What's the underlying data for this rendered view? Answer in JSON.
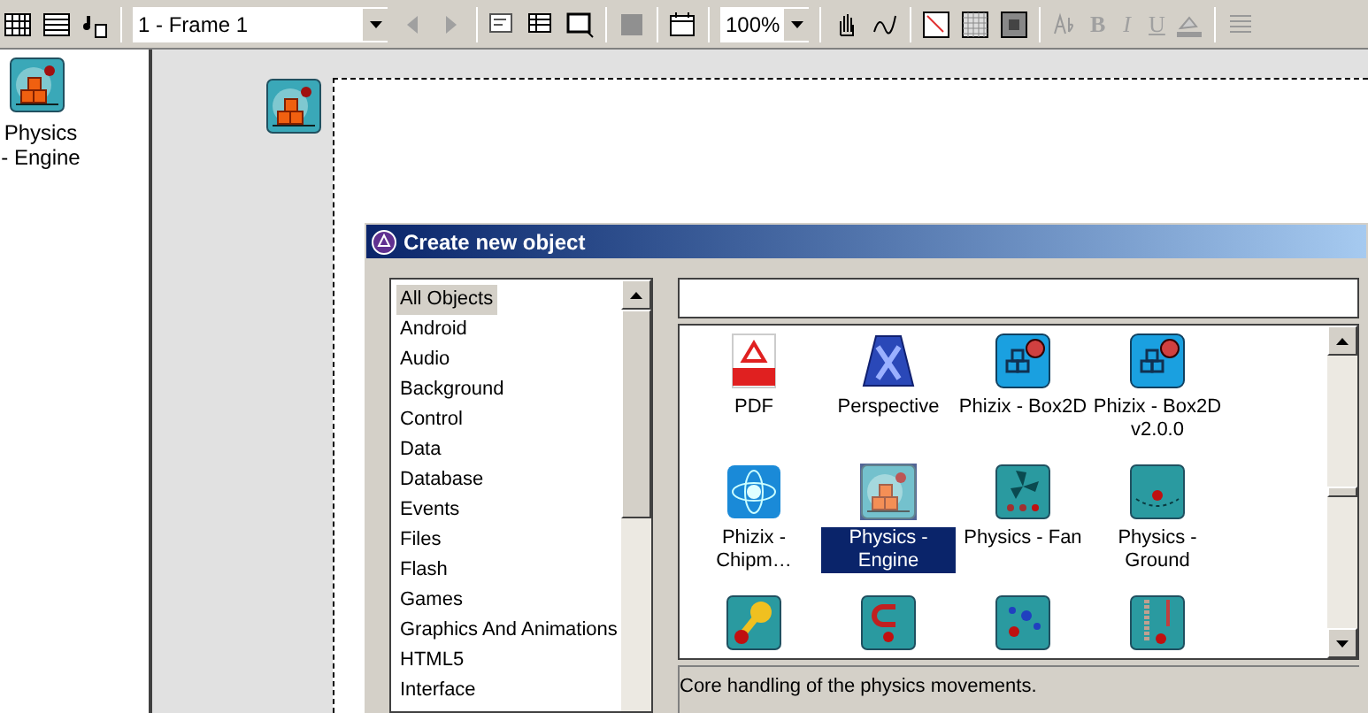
{
  "toolbar": {
    "frame_select": "1 - Frame 1",
    "zoom_select": "100%",
    "text_format": [
      "B",
      "I",
      "U"
    ]
  },
  "left_panel": {
    "object": {
      "label": "Physics - Engine"
    }
  },
  "dialog": {
    "title": "Create new object",
    "categories": [
      {
        "label": "All Objects",
        "selected": true
      },
      {
        "label": "Android",
        "selected": false
      },
      {
        "label": "Audio",
        "selected": false
      },
      {
        "label": "Background",
        "selected": false
      },
      {
        "label": "Control",
        "selected": false
      },
      {
        "label": "Data",
        "selected": false
      },
      {
        "label": "Database",
        "selected": false
      },
      {
        "label": "Events",
        "selected": false
      },
      {
        "label": "Files",
        "selected": false
      },
      {
        "label": "Flash",
        "selected": false
      },
      {
        "label": "Games",
        "selected": false
      },
      {
        "label": "Graphics And Animations",
        "selected": false
      },
      {
        "label": "HTML5",
        "selected": false
      },
      {
        "label": "Interface",
        "selected": false
      }
    ],
    "objects": [
      {
        "label": "PDF",
        "kind": "pdf",
        "selected": false
      },
      {
        "label": "Perspective",
        "kind": "perspective",
        "selected": false
      },
      {
        "label": "Phizix - Box2D",
        "kind": "box2d",
        "selected": false
      },
      {
        "label": "Phizix - Box2D v2.0.0",
        "kind": "box2d",
        "selected": false
      },
      {
        "label": "Phizix - Chipm…",
        "kind": "chipmunk",
        "selected": false
      },
      {
        "label": "Physics - Engine",
        "kind": "engine",
        "selected": true
      },
      {
        "label": "Physics - Fan",
        "kind": "fan",
        "selected": false
      },
      {
        "label": "Physics - Ground",
        "kind": "ground",
        "selected": false
      },
      {
        "kind": "pin",
        "selected": false
      },
      {
        "kind": "magnet",
        "selected": false
      },
      {
        "kind": "particles",
        "selected": false
      },
      {
        "kind": "spring",
        "selected": false
      }
    ],
    "description": "Core handling of the physics movements."
  }
}
